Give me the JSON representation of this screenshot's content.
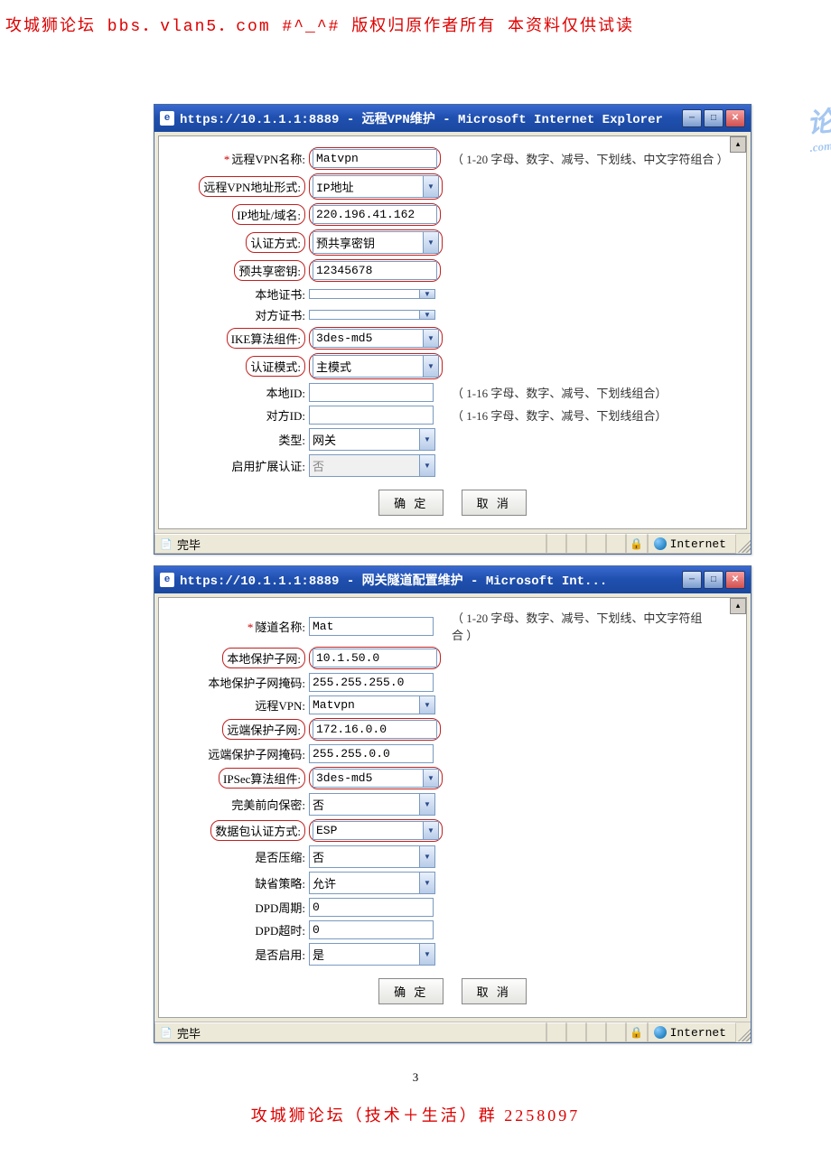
{
  "header_text": "攻城狮论坛  bbs．vlan5．com    #^_^#  版权归原作者所有   本资料仅供试读",
  "footer_text": "攻城狮论坛（技术＋生活）群   2258097",
  "page_number": "3",
  "watermark_top": "论坛",
  "watermark_sub": ".com",
  "status": {
    "done": "完毕",
    "zone": "Internet"
  },
  "buttons": {
    "ok": "确 定",
    "cancel": "取 消"
  },
  "win1": {
    "title": "https://10.1.1.1:8889 - 远程VPN维护 - Microsoft Internet Explorer",
    "fields": {
      "vpn_name": {
        "label": "远程VPN名称:",
        "value": "Matvpn",
        "hint": "（ 1-20 字母、数字、减号、下划线、中文字符组合 ）"
      },
      "addr_type": {
        "label": "远程VPN地址形式:",
        "value": "IP地址"
      },
      "ip_domain": {
        "label": "IP地址/域名:",
        "value": "220.196.41.162"
      },
      "auth_method": {
        "label": "认证方式:",
        "value": "预共享密钥"
      },
      "psk": {
        "label": "预共享密钥:",
        "value": "12345678"
      },
      "local_cert": {
        "label": "本地证书:",
        "value": ""
      },
      "peer_cert": {
        "label": "对方证书:",
        "value": ""
      },
      "ike": {
        "label": "IKE算法组件:",
        "value": "3des-md5"
      },
      "auth_mode": {
        "label": "认证模式:",
        "value": "主模式"
      },
      "local_id": {
        "label": "本地ID:",
        "value": "",
        "hint": "（ 1-16 字母、数字、减号、下划线组合）"
      },
      "peer_id": {
        "label": "对方ID:",
        "value": "",
        "hint": "（ 1-16 字母、数字、减号、下划线组合）"
      },
      "type": {
        "label": "类型:",
        "value": "网关"
      },
      "ext_auth": {
        "label": "启用扩展认证:",
        "value": "否"
      }
    }
  },
  "win2": {
    "title": "https://10.1.1.1:8889 - 网关隧道配置维护 - Microsoft Int...",
    "fields": {
      "tunnel_name": {
        "label": "隧道名称:",
        "value": "Mat",
        "hint": "（ 1-20 字母、数字、减号、下划线、中文字符组合 ）"
      },
      "local_subnet": {
        "label": "本地保护子网:",
        "value": "10.1.50.0"
      },
      "local_mask": {
        "label": "本地保护子网掩码:",
        "value": "255.255.255.0"
      },
      "remote_vpn": {
        "label": "远程VPN:",
        "value": "Matvpn"
      },
      "remote_subnet": {
        "label": "远端保护子网:",
        "value": "172.16.0.0"
      },
      "remote_mask": {
        "label": "远端保护子网掩码:",
        "value": "255.255.0.0"
      },
      "ipsec": {
        "label": "IPSec算法组件:",
        "value": "3des-md5"
      },
      "pfs": {
        "label": "完美前向保密:",
        "value": "否"
      },
      "pkt_auth": {
        "label": "数据包认证方式:",
        "value": "ESP"
      },
      "compress": {
        "label": "是否压缩:",
        "value": "否"
      },
      "default_policy": {
        "label": "缺省策略:",
        "value": "允许"
      },
      "dpd_period": {
        "label": "DPD周期:",
        "value": "0"
      },
      "dpd_timeout": {
        "label": "DPD超时:",
        "value": "0"
      },
      "enabled": {
        "label": "是否启用:",
        "value": "是"
      }
    }
  }
}
